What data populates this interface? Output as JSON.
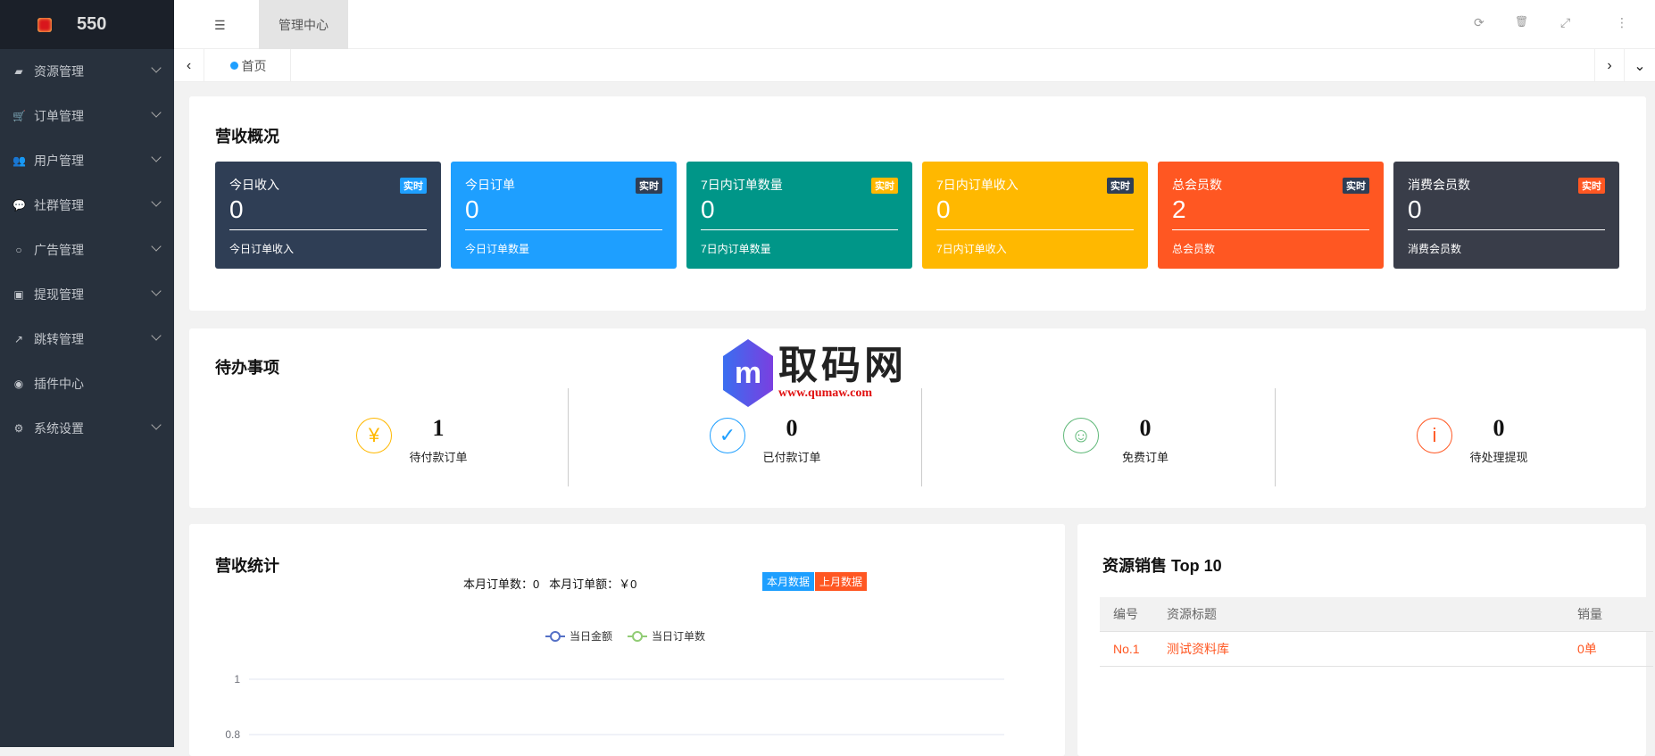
{
  "brand": {
    "name": "550"
  },
  "sidebar": {
    "items": [
      {
        "label": "资源管理",
        "icon": "book-icon",
        "glyph": "▰",
        "expand": true
      },
      {
        "label": "订单管理",
        "icon": "cart-icon",
        "glyph": "🛒",
        "expand": true
      },
      {
        "label": "用户管理",
        "icon": "users-icon",
        "glyph": "👥",
        "expand": true
      },
      {
        "label": "社群管理",
        "icon": "comments-icon",
        "glyph": "💬",
        "expand": true
      },
      {
        "label": "广告管理",
        "icon": "circle-icon",
        "glyph": "○",
        "expand": true
      },
      {
        "label": "提现管理",
        "icon": "money-icon",
        "glyph": "▣",
        "expand": true
      },
      {
        "label": "跳转管理",
        "icon": "share-icon",
        "glyph": "↗",
        "expand": true
      },
      {
        "label": "插件中心",
        "icon": "plugin-icon",
        "glyph": "◉",
        "expand": false
      },
      {
        "label": "系统设置",
        "icon": "gear-icon",
        "glyph": "⚙",
        "expand": true
      }
    ]
  },
  "header": {
    "menu_glyph": "☰",
    "active_tab": "管理中心",
    "refresh": "⟳",
    "delete": "🗑",
    "fullscreen": "⤢",
    "more": "⋮"
  },
  "tabs": {
    "prev": "‹",
    "next": "›",
    "dropdown": "⌄",
    "home": "首页"
  },
  "overview": {
    "title": "营收概况",
    "cards": [
      {
        "label": "今日收入",
        "value": "0",
        "badge": "实时",
        "sub": "今日订单收入",
        "bg": "#2f3e55",
        "badge_bg": "#1e9fff"
      },
      {
        "label": "今日订单",
        "value": "0",
        "badge": "实时",
        "sub": "今日订单数量",
        "bg": "#1e9fff",
        "badge_bg": "#2f3e55"
      },
      {
        "label": "7日内订单数量",
        "value": "0",
        "badge": "实时",
        "sub": "7日内订单数量",
        "bg": "#009688",
        "badge_bg": "#ffb800"
      },
      {
        "label": "7日内订单收入",
        "value": "0",
        "badge": "实时",
        "sub": "7日内订单收入",
        "bg": "#ffb800",
        "badge_bg": "#2f3e55"
      },
      {
        "label": "总会员数",
        "value": "2",
        "badge": "实时",
        "sub": "总会员数",
        "bg": "#ff5722",
        "badge_bg": "#2f3e55"
      },
      {
        "label": "消费会员数",
        "value": "0",
        "badge": "实时",
        "sub": "消费会员数",
        "bg": "#393d49",
        "badge_bg": "#ff5722"
      }
    ]
  },
  "todo": {
    "title": "待办事项",
    "items": [
      {
        "value": "1",
        "label": "待付款订单",
        "glyph": "¥",
        "color": "#ffb800",
        "icon": "yen-icon"
      },
      {
        "value": "0",
        "label": "已付款订单",
        "glyph": "✓",
        "color": "#1e9fff",
        "icon": "shield-check-icon"
      },
      {
        "value": "0",
        "label": "免费订单",
        "glyph": "☺",
        "color": "#5fb878",
        "icon": "smile-icon"
      },
      {
        "value": "0",
        "label": "待处理提现",
        "glyph": "i",
        "color": "#ff5722",
        "icon": "info-icon"
      }
    ]
  },
  "watermark": {
    "title": "取码网",
    "url": "www.qumaw.com",
    "letter": "m"
  },
  "stats": {
    "title": "营收统计",
    "summary": "本月订单数：0   本月订单额：￥0",
    "btn_this": "本月数据",
    "btn_last": "上月数据"
  },
  "chart_data": {
    "type": "line",
    "title": "",
    "legend": [
      "当日金额",
      "当日订单数"
    ],
    "legend_position": "top-center",
    "colors": [
      "#5470c6",
      "#91cc75"
    ],
    "yticks": [
      "1",
      "0.8"
    ],
    "ylim": [
      0,
      1
    ],
    "series": [
      {
        "name": "当日金额",
        "values": []
      },
      {
        "name": "当日订单数",
        "values": []
      }
    ],
    "grid": true
  },
  "top10": {
    "title": "资源销售 Top 10",
    "headers": [
      "编号",
      "资源标题",
      "销量"
    ],
    "rows": [
      [
        "No.1",
        "测试资料库",
        "0单"
      ]
    ]
  }
}
